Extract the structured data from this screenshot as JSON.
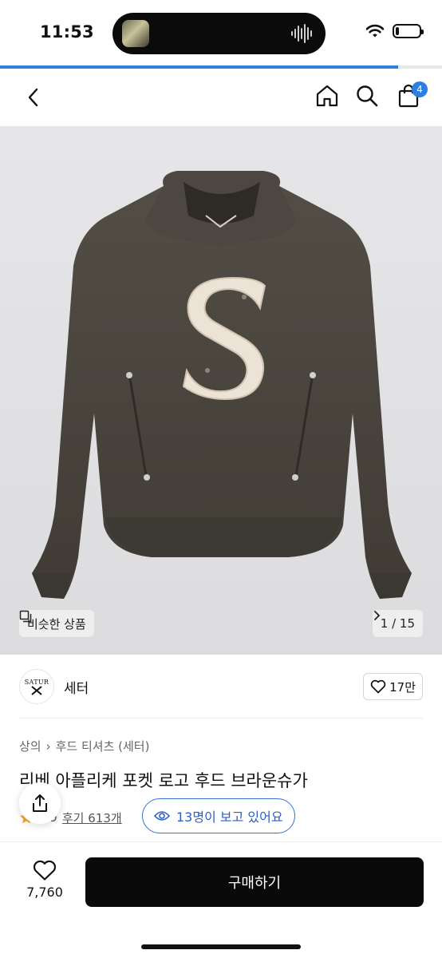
{
  "status_bar": {
    "time": "11:53",
    "icons": [
      "now-playing-artwork",
      "audio-waveform-icon",
      "wifi-icon",
      "battery-icon"
    ],
    "battery_level": 0.25
  },
  "page_load_progress": 0.9,
  "nav": {
    "back_icon": "chevron-left-icon",
    "home_icon": "home-icon",
    "search_icon": "search-icon",
    "cart_icon": "shopping-bag-icon",
    "cart_count": "4"
  },
  "gallery": {
    "similar_label": "비슷한 상품",
    "counter": "1 / 15",
    "similar_icon": "copy-icon",
    "next_icon": "chevron-right-icon"
  },
  "brand": {
    "logo_text_top": "SATUR",
    "name": "세터"
  },
  "like": {
    "count": "17만",
    "icon": "heart-outline-icon"
  },
  "breadcrumb": {
    "category": "상의",
    "separator": "›",
    "subcategory": "후드 티셔츠 (세터)"
  },
  "product": {
    "title": "리베 아플리케 포켓 로고 후드 브라운슈가",
    "rating": "4.9",
    "reviews": "후기 613개"
  },
  "viewing": {
    "text": "13명이 보고 있어요",
    "icon": "eye-icon"
  },
  "share_icon": "share-icon",
  "bottom": {
    "wish_count": "7,760",
    "buy_label": "구매하기"
  },
  "colors": {
    "accent": "#2d7fe0",
    "hoodie": "#4a463f",
    "logo_patch": "#ece3d6",
    "buy_button": "#0a0a0a"
  }
}
